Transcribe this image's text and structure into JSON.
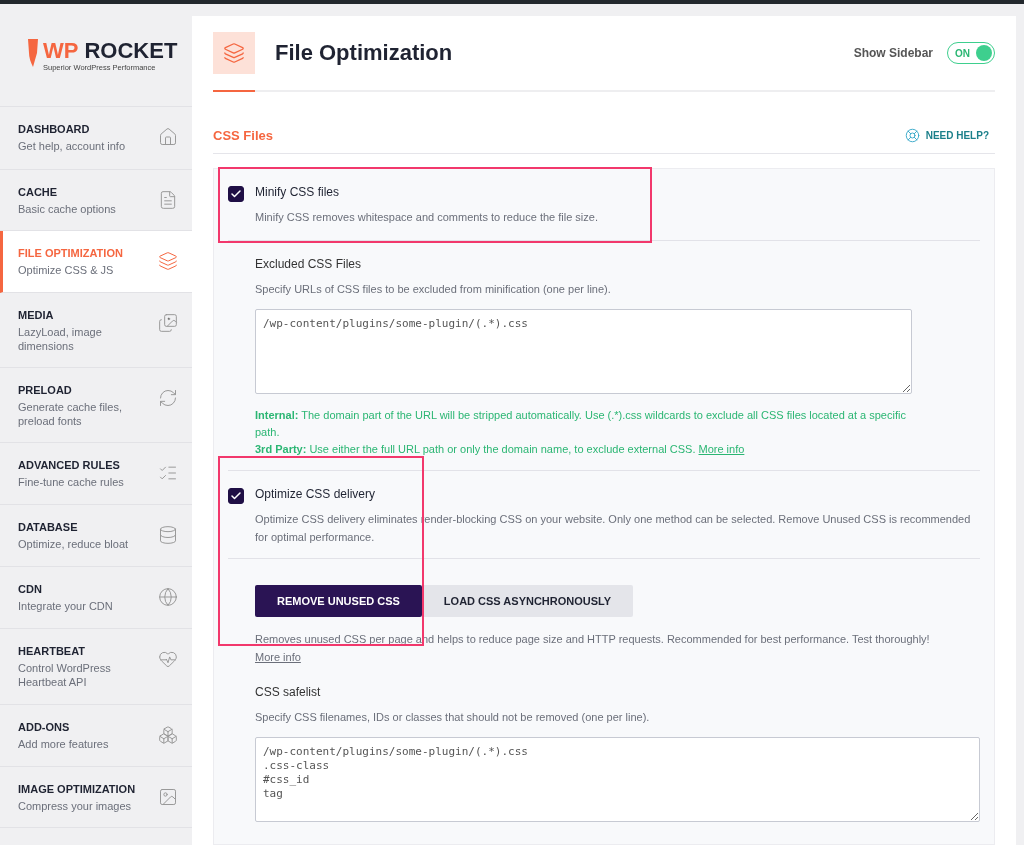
{
  "logo": {
    "brand_a": "WP",
    "brand_b": "ROCKET",
    "tagline": "Superior WordPress Performance"
  },
  "sidebar": {
    "items": [
      {
        "title": "DASHBOARD",
        "desc": "Get help, account info",
        "selected": false
      },
      {
        "title": "CACHE",
        "desc": "Basic cache options",
        "selected": false
      },
      {
        "title": "FILE OPTIMIZATION",
        "desc": "Optimize CSS & JS",
        "selected": true
      },
      {
        "title": "MEDIA",
        "desc": "LazyLoad, image dimensions",
        "selected": false
      },
      {
        "title": "PRELOAD",
        "desc": "Generate cache files, preload fonts",
        "selected": false
      },
      {
        "title": "ADVANCED RULES",
        "desc": "Fine-tune cache rules",
        "selected": false
      },
      {
        "title": "DATABASE",
        "desc": "Optimize, reduce bloat",
        "selected": false
      },
      {
        "title": "CDN",
        "desc": "Integrate your CDN",
        "selected": false
      },
      {
        "title": "HEARTBEAT",
        "desc": "Control WordPress Heartbeat API",
        "selected": false
      },
      {
        "title": "ADD-ONS",
        "desc": "Add more features",
        "selected": false
      },
      {
        "title": "IMAGE OPTIMIZATION",
        "desc": "Compress your images",
        "selected": false
      }
    ]
  },
  "header": {
    "title": "File Optimization",
    "sidebar_toggle": {
      "label": "Show Sidebar",
      "state_text": "ON",
      "on": true
    }
  },
  "section": {
    "title": "CSS Files",
    "help": "NEED HELP?"
  },
  "minify": {
    "label": "Minify CSS files",
    "checked": true,
    "desc": "Minify CSS removes whitespace and comments to reduce the file size.",
    "field": {
      "label": "Excluded CSS Files",
      "desc": "Specify URLs of CSS files to be excluded from minification (one per line).",
      "placeholder": "/wp-content/plugins/some-plugin/(.*).css"
    },
    "notes": [
      {
        "text": "**Internal:** The domain part of the URL will be stripped automatically. Use (.*).css wildcards to exclude all CSS files located at a specific path."
      },
      {
        "text": "**3rd Party:** Use either the full URL path or only the domain name, to exclude external CSS.",
        "link": "More info"
      }
    ]
  },
  "delivery": {
    "label": "Optimize CSS delivery",
    "checked": true,
    "desc": "Optimize CSS delivery eliminates render-blocking CSS on your website. Only one method can be selected. Remove Unused CSS is recommended for optimal performance.",
    "methods": [
      {
        "label": "REMOVE UNUSED CSS",
        "selected": true
      },
      {
        "label": "LOAD CSS ASYNCHRONOUSLY",
        "selected": false
      }
    ],
    "method_desc": "Removes unused CSS per page and helps to reduce page size and HTTP requests. Recommended for best performance. Test thoroughly!",
    "method_link": "More info",
    "field": {
      "label": "CSS safelist",
      "desc": "Specify CSS filenames, IDs or classes that should not be removed (one per line).",
      "placeholder": "/wp-content/plugins/some-plugin/(.*).css\n.css-class\n#css_id\ntag"
    }
  }
}
